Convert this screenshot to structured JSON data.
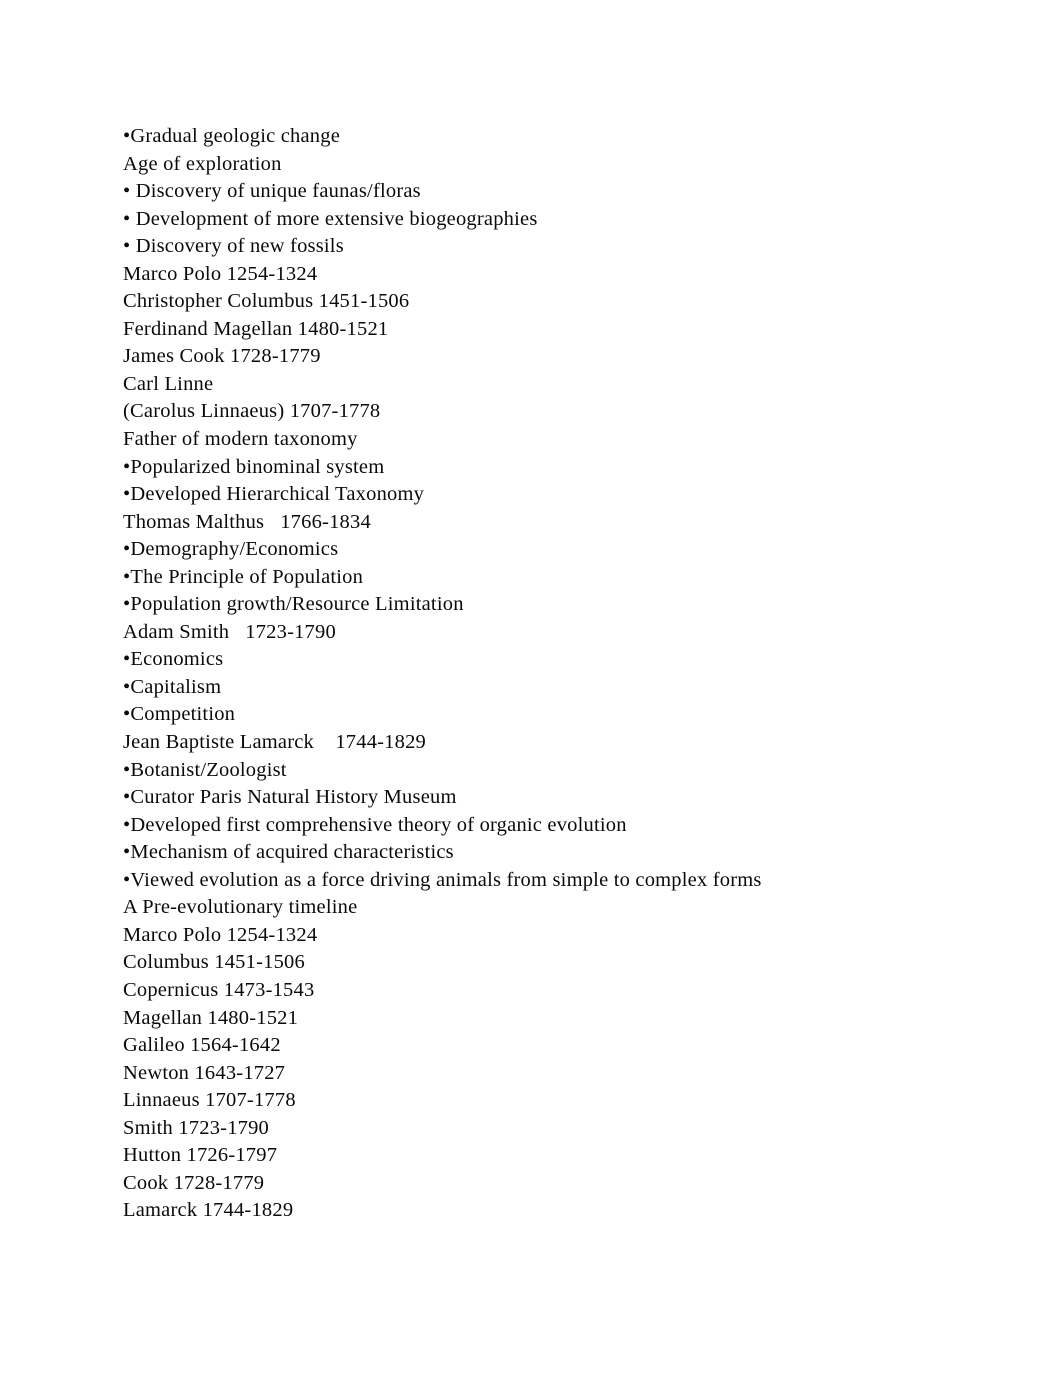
{
  "document": {
    "background_color": "#ffffff",
    "text_color": "#0a0a0a",
    "lines": [
      {
        "id": "line-1",
        "text": "•Gradual geologic change"
      },
      {
        "id": "line-2",
        "text": "Age of exploration"
      },
      {
        "id": "line-3",
        "text": "• Discovery of unique faunas/floras"
      },
      {
        "id": "line-4",
        "text": "• Development of more extensive biogeographies"
      },
      {
        "id": "line-5",
        "text": "• Discovery of new fossils"
      },
      {
        "id": "line-6",
        "text": "Marco Polo 1254-1324"
      },
      {
        "id": "line-7",
        "text": "Christopher Columbus 1451-1506"
      },
      {
        "id": "line-8",
        "text": "Ferdinand Magellan 1480-1521"
      },
      {
        "id": "line-9",
        "text": "James Cook 1728-1779"
      },
      {
        "id": "line-10",
        "text": "Carl Linne"
      },
      {
        "id": "line-11",
        "text": "(Carolus Linnaeus) 1707-1778"
      },
      {
        "id": "line-12",
        "text": "Father of modern taxonomy"
      },
      {
        "id": "line-13",
        "text": "•Popularized binominal system"
      },
      {
        "id": "line-14",
        "text": "•Developed Hierarchical Taxonomy"
      },
      {
        "id": "line-15",
        "text": "Thomas Malthus   1766-1834"
      },
      {
        "id": "line-16",
        "text": "•Demography/Economics"
      },
      {
        "id": "line-17",
        "text": "•The Principle of Population"
      },
      {
        "id": "line-18",
        "text": "•Population growth/Resource Limitation"
      },
      {
        "id": "line-19",
        "text": "Adam Smith   1723-1790"
      },
      {
        "id": "line-20",
        "text": "•Economics"
      },
      {
        "id": "line-21",
        "text": "•Capitalism"
      },
      {
        "id": "line-22",
        "text": "•Competition"
      },
      {
        "id": "line-23",
        "text": "Jean Baptiste Lamarck    1744-1829"
      },
      {
        "id": "line-24",
        "text": "•Botanist/Zoologist"
      },
      {
        "id": "line-25",
        "text": "•Curator Paris Natural History Museum"
      },
      {
        "id": "line-26",
        "text": "•Developed first comprehensive theory of organic evolution"
      },
      {
        "id": "line-27",
        "text": "•Mechanism of acquired characteristics"
      },
      {
        "id": "line-28",
        "text": "•Viewed evolution as a force driving animals from simple to complex forms"
      },
      {
        "id": "line-29",
        "text": "A Pre-evolutionary timeline"
      },
      {
        "id": "line-30",
        "text": "Marco Polo 1254-1324"
      },
      {
        "id": "line-31",
        "text": "Columbus 1451-1506"
      },
      {
        "id": "line-32",
        "text": "Copernicus 1473-1543"
      },
      {
        "id": "line-33",
        "text": "Magellan 1480-1521"
      },
      {
        "id": "line-34",
        "text": "Galileo 1564-1642"
      },
      {
        "id": "line-35",
        "text": "Newton 1643-1727"
      },
      {
        "id": "line-36",
        "text": "Linnaeus 1707-1778"
      },
      {
        "id": "line-37",
        "text": "Smith 1723-1790"
      },
      {
        "id": "line-38",
        "text": "Hutton 1726-1797"
      },
      {
        "id": "line-39",
        "text": "Cook 1728-1779"
      },
      {
        "id": "line-40",
        "text": "Lamarck 1744-1829"
      }
    ]
  }
}
